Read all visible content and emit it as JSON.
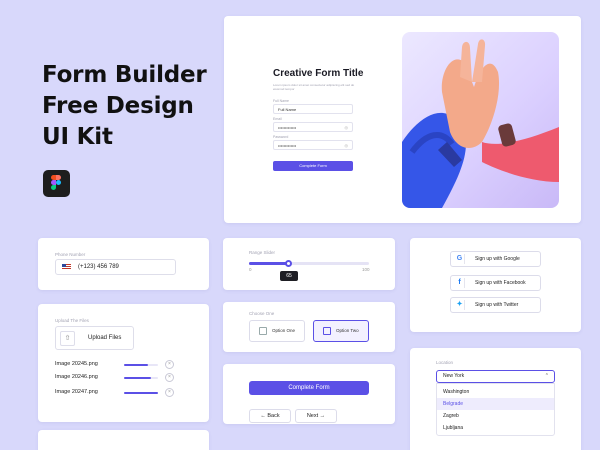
{
  "headline": {
    "line1": "Form Builder",
    "line2": "Free Design",
    "line3": "UI Kit"
  },
  "hero": {
    "title": "Creative Form Title",
    "subtitle": "Lorem ipsum dolor sit amet consectetur adipiscing elit sed do eiusmod tempor",
    "name_label": "Full Name",
    "name_value": "Full Name",
    "email_label": "Email",
    "email_value": "•••••••••••••",
    "password_label": "Password",
    "password_value": "•••••••••••••",
    "submit_label": "Complete Form"
  },
  "phone": {
    "label": "Phone Number",
    "value": "(+123) 456 789"
  },
  "upload": {
    "label": "Upload The Files",
    "button_label": "Upload Files",
    "files": [
      {
        "name": "Image 20245.png",
        "progress": 0.7
      },
      {
        "name": "Image 20246.png",
        "progress": 0.8
      },
      {
        "name": "Image 20247.png",
        "progress": 1.0
      }
    ]
  },
  "range": {
    "label": "Range Slider",
    "min": "0",
    "max": "100",
    "value": "65",
    "fraction": 0.33
  },
  "choose": {
    "label": "Choose One",
    "option1": "Option One",
    "option2": "Option Two",
    "selected": "Option Two"
  },
  "complete": {
    "button_label": "Complete Form",
    "back_label": "Back",
    "next_label": "Next"
  },
  "social": {
    "google": "Sign up with Google",
    "facebook": "Sign up with Facebook",
    "twitter": "Sign up with Twitter"
  },
  "location": {
    "label": "Location",
    "selected": "New York",
    "options": [
      "Washington",
      "Belgrade",
      "Zagreb",
      "Ljubljana"
    ],
    "highlighted": "Belgrade"
  },
  "colors": {
    "accent": "#5b50e6",
    "background": "#d8d8fb"
  }
}
